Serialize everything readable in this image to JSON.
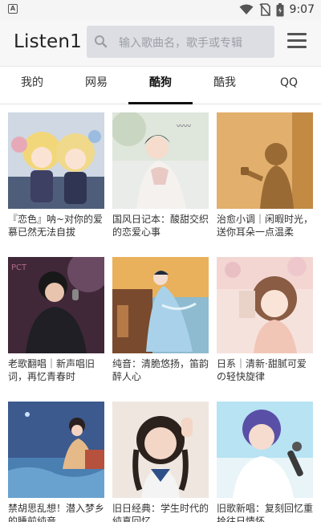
{
  "status_bar": {
    "time": "9:07",
    "icons": [
      "notification-a-icon",
      "wifi-icon",
      "no-sim-icon",
      "battery-icon"
    ]
  },
  "app_bar": {
    "title": "Listen1",
    "search_placeholder": "输入歌曲名，歌手或专辑",
    "icons": [
      "search-icon",
      "menu-icon"
    ]
  },
  "tabs": [
    {
      "label": "我的",
      "active": false
    },
    {
      "label": "网易",
      "active": false
    },
    {
      "label": "酷狗",
      "active": true
    },
    {
      "label": "酷我",
      "active": false
    },
    {
      "label": "QQ",
      "active": false
    }
  ],
  "playlists": [
    {
      "title": "『恋色』呐~对你的爱慕已然无法自拔"
    },
    {
      "title": "国风日记本：酸甜交织的恋爱心事"
    },
    {
      "title": "治愈小调｜闲暇时光，送你耳朵一点温柔"
    },
    {
      "title": "老歌翻唱｜新声唱旧词，再忆青春时"
    },
    {
      "title": "纯音：清脆悠扬，笛韵醉人心"
    },
    {
      "title": "日系｜清新·甜腻可爱の轻快旋律"
    },
    {
      "title": "禁胡思乱想！潜入梦乡的睡前纯音"
    },
    {
      "title": "旧日经典：学生时代的纯真回忆"
    },
    {
      "title": "旧歌新唱：复刻回忆重拾往日情怀"
    }
  ],
  "colors": {
    "app_bar_bg": "#f7f7f7",
    "search_bg": "#dcdee3",
    "active_tab_indicator": "#111111"
  }
}
